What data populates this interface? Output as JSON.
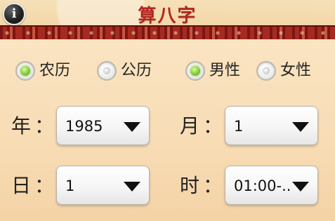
{
  "header": {
    "title": "算八字",
    "info_label": "i"
  },
  "calendar_options": [
    {
      "label": "农历",
      "selected": true
    },
    {
      "label": "公历",
      "selected": false
    }
  ],
  "gender_options": [
    {
      "label": "男性",
      "selected": true
    },
    {
      "label": "女性",
      "selected": false
    }
  ],
  "fields": {
    "year": {
      "label": "年",
      "colon": "：",
      "value": "1985"
    },
    "month": {
      "label": "月",
      "colon": "：",
      "value": "1"
    },
    "day": {
      "label": "日",
      "colon": "：",
      "value": "1"
    },
    "hour": {
      "label": "时",
      "colon": "：",
      "value": "01:00-.."
    }
  },
  "colors": {
    "header_band": "#a42a1f",
    "title_red": "#b3261e",
    "radio_selected_green": "#86c83b",
    "background": "#f8ddb6"
  }
}
